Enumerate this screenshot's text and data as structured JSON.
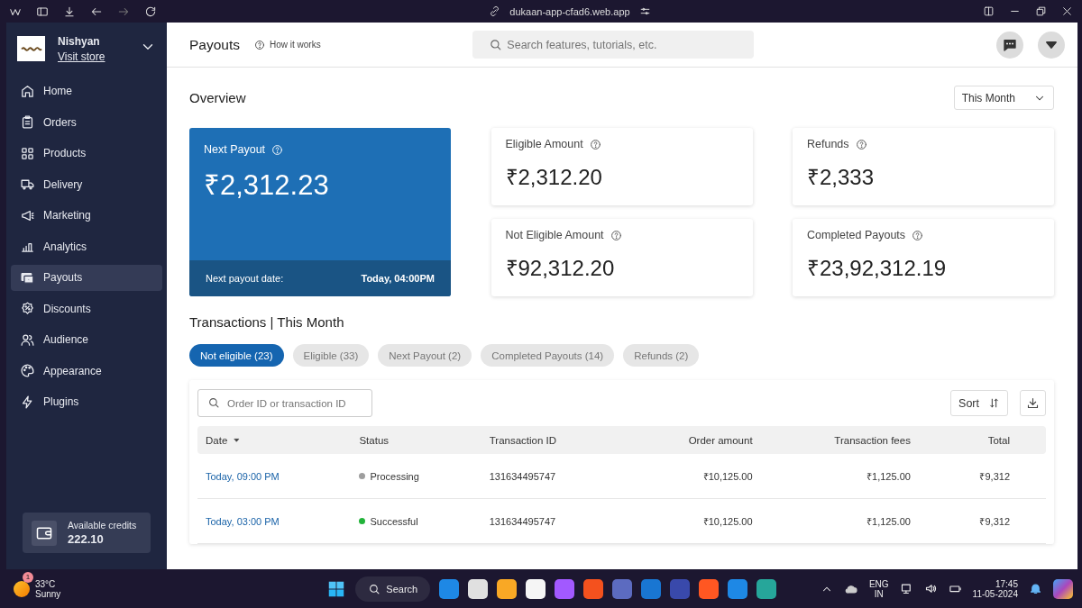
{
  "browser": {
    "url": "dukaan-app-cfad6.web.app"
  },
  "sidebar": {
    "store_name": "Nishyan",
    "store_link": "Visit store",
    "items": [
      {
        "label": "Home",
        "selected": false
      },
      {
        "label": "Orders",
        "selected": false
      },
      {
        "label": "Products",
        "selected": false
      },
      {
        "label": "Delivery",
        "selected": false
      },
      {
        "label": "Marketing",
        "selected": false
      },
      {
        "label": "Analytics",
        "selected": false
      },
      {
        "label": "Payouts",
        "selected": true
      },
      {
        "label": "Discounts",
        "selected": false
      },
      {
        "label": "Audience",
        "selected": false
      },
      {
        "label": "Appearance",
        "selected": false
      },
      {
        "label": "Plugins",
        "selected": false
      }
    ],
    "credits": {
      "label": "Available credits",
      "value": "222.10"
    }
  },
  "header": {
    "title": "Payouts",
    "help_link": "How it works",
    "search": {
      "placeholder": "Search features, tutorials, etc."
    }
  },
  "overview": {
    "title": "Overview",
    "period": "This Month",
    "next_payout": {
      "label": "Next Payout",
      "amount": "₹2,312.23",
      "date_label": "Next payout date:",
      "date": "Today, 04:00PM"
    },
    "stats": [
      {
        "label": "Eligible Amount",
        "amount": "₹2,312.20"
      },
      {
        "label": "Refunds",
        "amount": "₹2,333"
      },
      {
        "label": "Not Eligible Amount",
        "amount": "₹92,312.20"
      },
      {
        "label": "Completed Payouts",
        "amount": "₹23,92,312.19"
      }
    ]
  },
  "transactions": {
    "title": "Transactions | This Month",
    "filters": [
      {
        "label": "Not eligible (23)",
        "selected": true
      },
      {
        "label": "Eligible (33)",
        "selected": false
      },
      {
        "label": "Next Payout (2)",
        "selected": false
      },
      {
        "label": "Completed Payouts (14)",
        "selected": false
      },
      {
        "label": "Refunds (2)",
        "selected": false
      }
    ],
    "search": {
      "placeholder": "Order ID or transaction ID"
    },
    "sort_label": "Sort",
    "columns": [
      "Date",
      "Status",
      "Transaction ID",
      "Order amount",
      "Transaction fees",
      "Total"
    ],
    "rows": [
      {
        "date": "Today, 09:00 PM",
        "status": "Processing",
        "color": "#9e9e9e",
        "transaction_id": "131634495747",
        "order_amount": "₹10,125.00",
        "fees": "₹1,125.00",
        "total": "₹9,312"
      },
      {
        "date": "Today, 03:00 PM",
        "status": "Successful",
        "color": "#22b33a",
        "transaction_id": "131634495747",
        "order_amount": "₹10,125.00",
        "fees": "₹1,125.00",
        "total": "₹9,312"
      }
    ]
  },
  "taskbar": {
    "weather": {
      "temp": "33°C",
      "condition": "Sunny",
      "badge": "1"
    },
    "search": "Search",
    "language": "ENG",
    "region": "IN",
    "time": "17:45",
    "date": "11-05-2024"
  }
}
